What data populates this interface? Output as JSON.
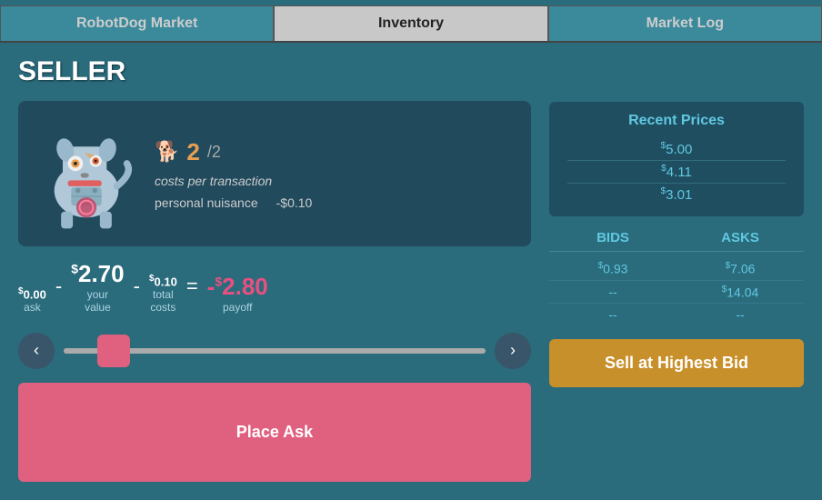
{
  "tabs": [
    {
      "id": "robotdog",
      "label": "RobotDog Market",
      "active": false
    },
    {
      "id": "inventory",
      "label": "Inventory",
      "active": true
    },
    {
      "id": "marketlog",
      "label": "Market Log",
      "active": false
    }
  ],
  "seller": {
    "title": "SELLER",
    "item": {
      "count": "2",
      "count_max": "/2",
      "costs_label": "costs per transaction",
      "nuisance_label": "personal nuisance",
      "nuisance_value": "-$0.10"
    },
    "payoff": {
      "ask_sup": "$",
      "ask_val": "0.00",
      "ask_label": "ask",
      "sep1": "-",
      "your_sup": "$",
      "your_val": "2.70",
      "your_label1": "your",
      "your_label2": "value",
      "sep2": "-",
      "cost_sup": "$",
      "cost_val": "0.10",
      "cost_label1": "total",
      "cost_label2": "costs",
      "equals": "=",
      "payoff_sign": "-",
      "payoff_sup": "$",
      "payoff_val": "2.80",
      "payoff_label": "payoff"
    },
    "place_ask_label": "Place Ask"
  },
  "right": {
    "recent_prices_title": "Recent Prices",
    "prices": [
      {
        "sup": "$",
        "val": "5.00"
      },
      {
        "sup": "$",
        "val": "4.11"
      },
      {
        "sup": "$",
        "val": "3.01"
      }
    ],
    "bids_header": "BIDS",
    "asks_header": "ASKS",
    "bids": [
      {
        "sup": "$",
        "val": "0.93"
      },
      {
        "val": "--"
      },
      {
        "val": "--"
      }
    ],
    "asks": [
      {
        "sup": "$",
        "val": "7.06"
      },
      {
        "sup": "$",
        "val": "14.04"
      },
      {
        "val": "--"
      }
    ],
    "sell_label": "Sell at Highest Bid"
  }
}
